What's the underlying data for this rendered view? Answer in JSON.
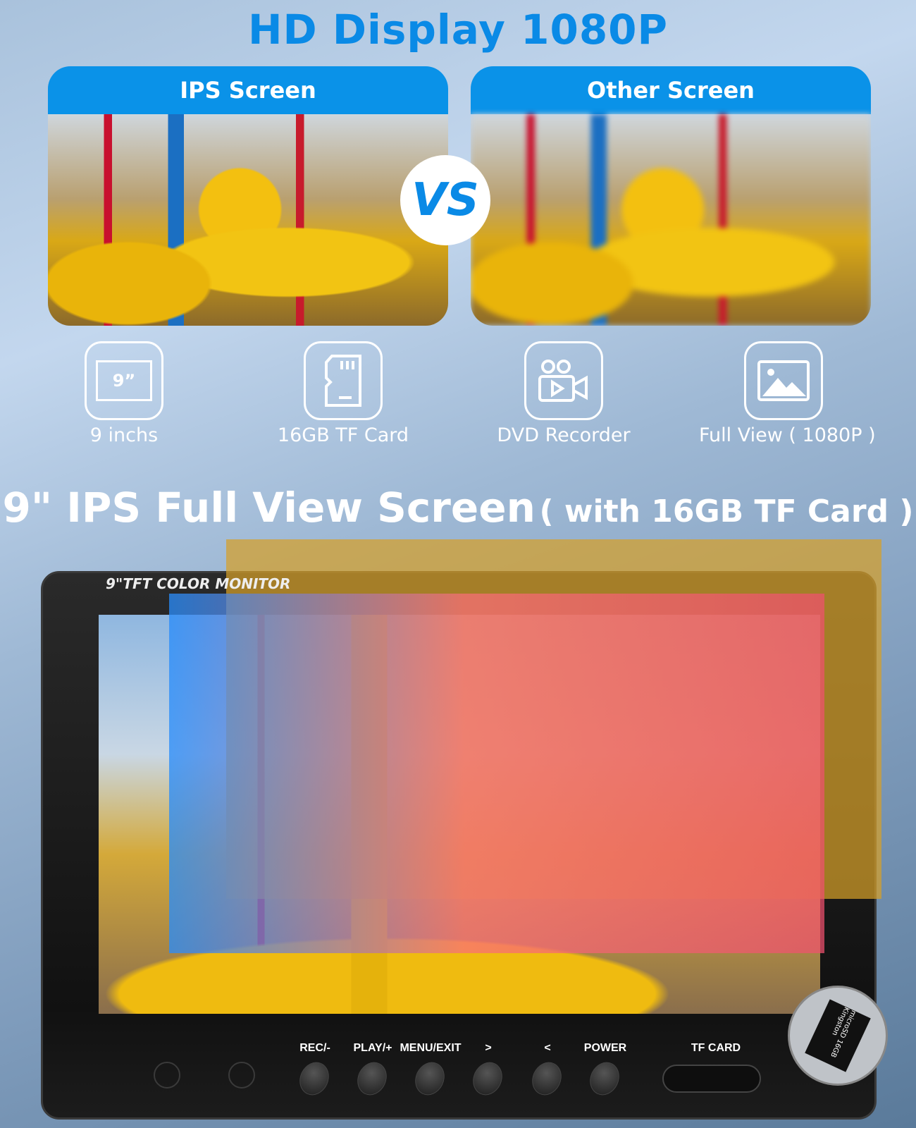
{
  "header": {
    "title": "HD Display 1080P"
  },
  "comparison": {
    "left": {
      "label": "IPS Screen"
    },
    "right": {
      "label": "Other Screen"
    },
    "vs_badge": "VS"
  },
  "features": [
    {
      "icon": "screen-size-icon",
      "icon_text": "9”",
      "label": "9 inchs"
    },
    {
      "icon": "sd-card-icon",
      "label": "16GB TF Card"
    },
    {
      "icon": "video-camera-icon",
      "label": "DVD Recorder"
    },
    {
      "icon": "image-icon",
      "label": "Full View ( 1080P )"
    }
  ],
  "subtitle": {
    "main": "9\" IPS Full View Screen",
    "detail": "( with 16GB TF Card )"
  },
  "monitor": {
    "brand": "9\"TFT COLOR MONITOR",
    "buttons": [
      "REC/-",
      "PLAY/+",
      "MENU/EXIT",
      ">",
      "<",
      "POWER"
    ],
    "slot_label": "TF CARD",
    "card_text": "microSD 16GB Kingston"
  },
  "colors": {
    "accent": "#0a8ae6",
    "header_bar": "#0a92e8"
  }
}
